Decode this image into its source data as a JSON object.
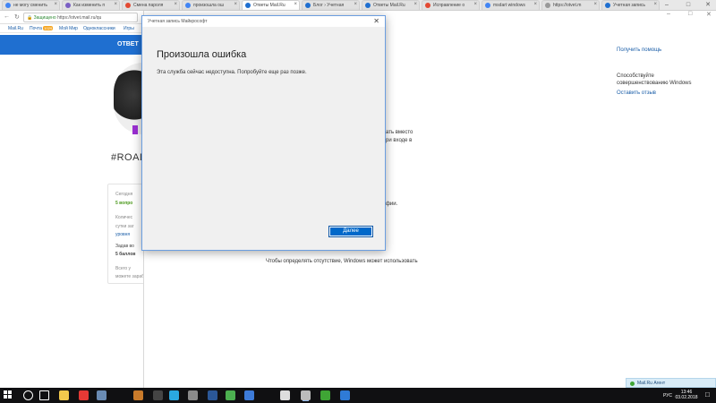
{
  "browser": {
    "tabs": [
      {
        "label": "не могу сменить",
        "color": "#4285f4"
      },
      {
        "label": "Как изменить п",
        "color": "#7a5fc4"
      },
      {
        "label": "Смена пароля",
        "color": "#e34a33"
      },
      {
        "label": "произошла ош",
        "color": "#4285f4"
      },
      {
        "label": "Ответы Mail.Ru",
        "color": "#1f6fd0",
        "active": true
      },
      {
        "label": "Блог › Учетная",
        "color": "#1f6fd0"
      },
      {
        "label": "Ответы Mail.Ru",
        "color": "#1f6fd0"
      },
      {
        "label": "Исправление о",
        "color": "#e34a33"
      },
      {
        "label": "msdart windows",
        "color": "#4285f4"
      },
      {
        "label": "https://otvet.m",
        "color": "#999999"
      },
      {
        "label": "Учетная запись",
        "color": "#1f6fd0"
      }
    ],
    "address": {
      "secure_label": "Защищено",
      "url": "https://otvet.mail.ru/qu"
    }
  },
  "mailru_nav": {
    "items": [
      "Mail.Ru",
      "Почта",
      "Мой Мир",
      "Одноклассники",
      "Игры"
    ],
    "badge": "1029"
  },
  "site": {
    "header_label": "ОТВЕТ",
    "nickname": "#ROAD",
    "stats": [
      "Сегодня",
      "5 вопро",
      "Количес",
      "сутки заг",
      "уровня",
      "Задав во",
      "5 баллов",
      "Всего у",
      "можете заработать больше"
    ]
  },
  "settings_window": {
    "help_link": "Получить помощь",
    "improve_text": "Способствуйте совершенствованию Windows",
    "feedback_link": "Оставить отзыв",
    "fragments": [
      "ать вместо",
      "ри входе в",
      "фии.",
      "Чтобы определять отсутствие, Windows может использовать"
    ]
  },
  "dialog": {
    "window_title": "Учетная запись Майкрософт",
    "heading": "Произошла ошибка",
    "message": "Эта служба сейчас недоступна. Попробуйте еще раз позже.",
    "next_button": "Далее"
  },
  "agent_popup": {
    "label": "Mail.Ru Агент"
  },
  "taskbar": {
    "language": "РУС",
    "time": "13:46",
    "date": "03.02.2018",
    "icons": [
      {
        "name": "search-icon",
        "color": "#ffffff"
      },
      {
        "name": "task-view-icon",
        "color": "#ffffff"
      },
      {
        "name": "file-explorer-icon",
        "color": "#f2c94c"
      },
      {
        "name": "opera-icon",
        "color": "#e53935"
      },
      {
        "name": "steam-icon",
        "color": "#6a8bb3"
      },
      {
        "name": "app-icon",
        "color": "#c97b2b"
      },
      {
        "name": "media-icon",
        "color": "#444444"
      },
      {
        "name": "skype-icon",
        "color": "#2aa8e0"
      },
      {
        "name": "mail-icon",
        "color": "#8a8a8a"
      },
      {
        "name": "word-icon",
        "color": "#2b5797"
      },
      {
        "name": "chrome-icon",
        "color": "#4caf50"
      },
      {
        "name": "photo-icon",
        "color": "#3d7bd8"
      },
      {
        "name": "alien-icon",
        "color": "#dddddd"
      },
      {
        "name": "settings-icon",
        "color": "#bbbbbb"
      },
      {
        "name": "money-icon",
        "color": "#3fa535"
      },
      {
        "name": "onedrive-icon",
        "color": "#2f7bd6"
      }
    ]
  }
}
